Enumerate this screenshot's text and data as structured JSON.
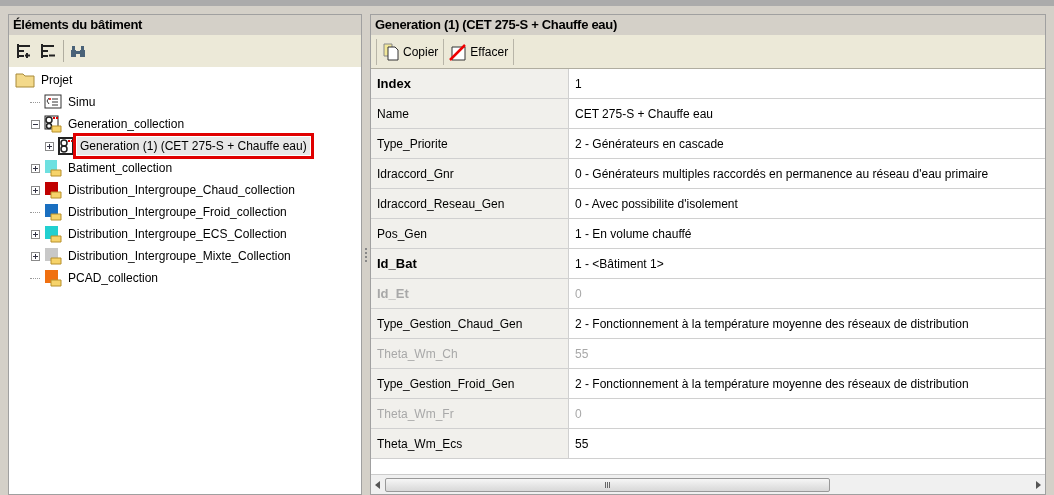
{
  "left_panel": {
    "title": "Éléments du bâtiment",
    "tree": [
      {
        "label": "Projet",
        "kind": "folder",
        "selected": false,
        "children": [
          {
            "label": "Simu",
            "kind": "script",
            "selected": false
          },
          {
            "label": "Generation_collection",
            "kind": "generators",
            "expanded": true,
            "selected": false,
            "children": [
              {
                "label": "Generation (1) (CET 275-S + Chauffe eau)",
                "kind": "generator",
                "expanded": false,
                "selected": true
              }
            ]
          },
          {
            "label": "Batiment_collection",
            "kind": "buildings",
            "expanded": false,
            "selected": false
          },
          {
            "label": "Distribution_Intergroupe_Chaud_collection",
            "kind": "collection",
            "color": "#c00000",
            "expanded": false,
            "selected": false
          },
          {
            "label": "Distribution_Intergroupe_Froid_collection",
            "kind": "collection",
            "color": "#1a6fc0",
            "selected": false
          },
          {
            "label": "Distribution_Intergroupe_ECS_Collection",
            "kind": "collection",
            "color": "#22d0d0",
            "expanded": false,
            "selected": false
          },
          {
            "label": "Distribution_Intergroupe_Mixte_Collection",
            "kind": "collection",
            "color": "#c8c8c8",
            "expanded": false,
            "selected": false
          },
          {
            "label": "PCAD_collection",
            "kind": "collection",
            "color": "#f07010",
            "selected": false
          }
        ]
      }
    ]
  },
  "right_panel": {
    "title": "Generation (1) (CET 275-S + Chauffe eau)",
    "toolbar": [
      {
        "label": "Copier",
        "kind": "copy"
      },
      {
        "label": "Effacer",
        "kind": "erase"
      }
    ],
    "properties": [
      {
        "name": "Index",
        "value": "1",
        "bold": true,
        "disabled": false
      },
      {
        "name": "Name",
        "value": "CET 275-S + Chauffe eau",
        "bold": false,
        "disabled": false
      },
      {
        "name": "Type_Priorite",
        "value": "2 - Générateurs en cascade",
        "bold": false,
        "disabled": false
      },
      {
        "name": "Idraccord_Gnr",
        "value": "0 - Générateurs multiples raccordés en permanence au réseau d'eau primaire",
        "bold": false,
        "disabled": false
      },
      {
        "name": "Idraccord_Reseau_Gen",
        "value": "0 - Avec possibilite d'isolement",
        "bold": false,
        "disabled": false
      },
      {
        "name": "Pos_Gen",
        "value": "1 - En volume chauffé",
        "bold": false,
        "disabled": false
      },
      {
        "name": "Id_Bat",
        "value": "1 - <Bâtiment 1>",
        "bold": true,
        "disabled": false
      },
      {
        "name": "Id_Et",
        "value": "0",
        "bold": true,
        "disabled": true
      },
      {
        "name": "Type_Gestion_Chaud_Gen",
        "value": "2 - Fonctionnement à la température moyenne des réseaux de distribution",
        "bold": false,
        "disabled": false
      },
      {
        "name": "Theta_Wm_Ch",
        "value": "55",
        "bold": false,
        "disabled": true
      },
      {
        "name": "Type_Gestion_Froid_Gen",
        "value": "2 - Fonctionnement à la température moyenne des réseaux de distribution",
        "bold": false,
        "disabled": false
      },
      {
        "name": "Theta_Wm_Fr",
        "value": "0",
        "bold": false,
        "disabled": true
      },
      {
        "name": "Theta_Wm_Ecs",
        "value": "55",
        "bold": false,
        "disabled": false
      }
    ]
  }
}
